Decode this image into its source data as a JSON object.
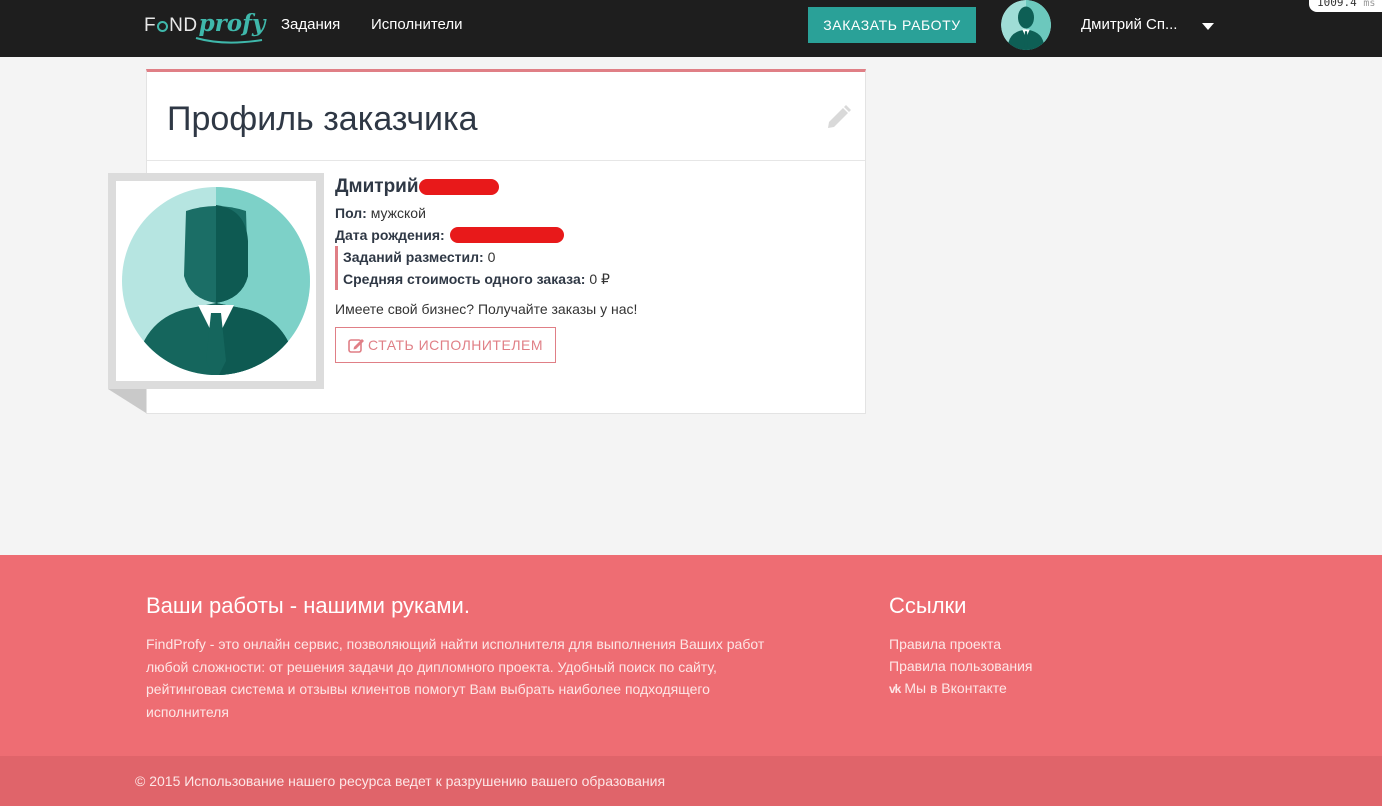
{
  "nav": {
    "logo_find_left": "F",
    "logo_find_right": "ND",
    "logo_profy": "profy",
    "tasks": "Задания",
    "performers": "Исполнители",
    "order_button": "ЗАКАЗАТЬ РАБОТУ",
    "username": "Дмитрий Сп...",
    "timer_value": "1009.4",
    "timer_unit": "ms"
  },
  "profile": {
    "title": "Профиль заказчика",
    "name": "Дмитрий",
    "gender_label": "Пол:",
    "gender_value": "мужской",
    "birth_label": "Дата рождения:",
    "tasks_label": "Заданий разместил:",
    "tasks_value": "0",
    "avg_cost_label": "Средняя стоимость одного заказа:",
    "avg_cost_value": "0 ₽",
    "promo_text": "Имеете свой бизнес? Получайте заказы у нас!",
    "become_button": "СТАТЬ ИСПОЛНИТЕЛЕМ"
  },
  "footer": {
    "heading": "Ваши работы - нашими руками.",
    "text": "FindProfy - это онлайн сервис, позволяющий найти исполнителя для выполнения Ваших работ любой сложности: от решения задачи до дипломного проекта. Удобный поиск по сайту, рейтинговая система и отзывы клиентов помогут Вам выбрать наиболее подходящего исполнителя",
    "links_heading": "Ссылки",
    "links": [
      "Правила проекта",
      "Правила пользования",
      "Мы в Вконтакте"
    ],
    "vk_icon": "vk-icon",
    "copyright": "© 2015 Использование нашего ресурса ведет к разрушению вашего образования"
  },
  "colors": {
    "accent_teal": "#2aa198",
    "accent_pink": "#e07f86",
    "footer_bg": "#ee6d73",
    "navbar_bg": "#1e1e1e",
    "redaction": "#e8191a"
  }
}
